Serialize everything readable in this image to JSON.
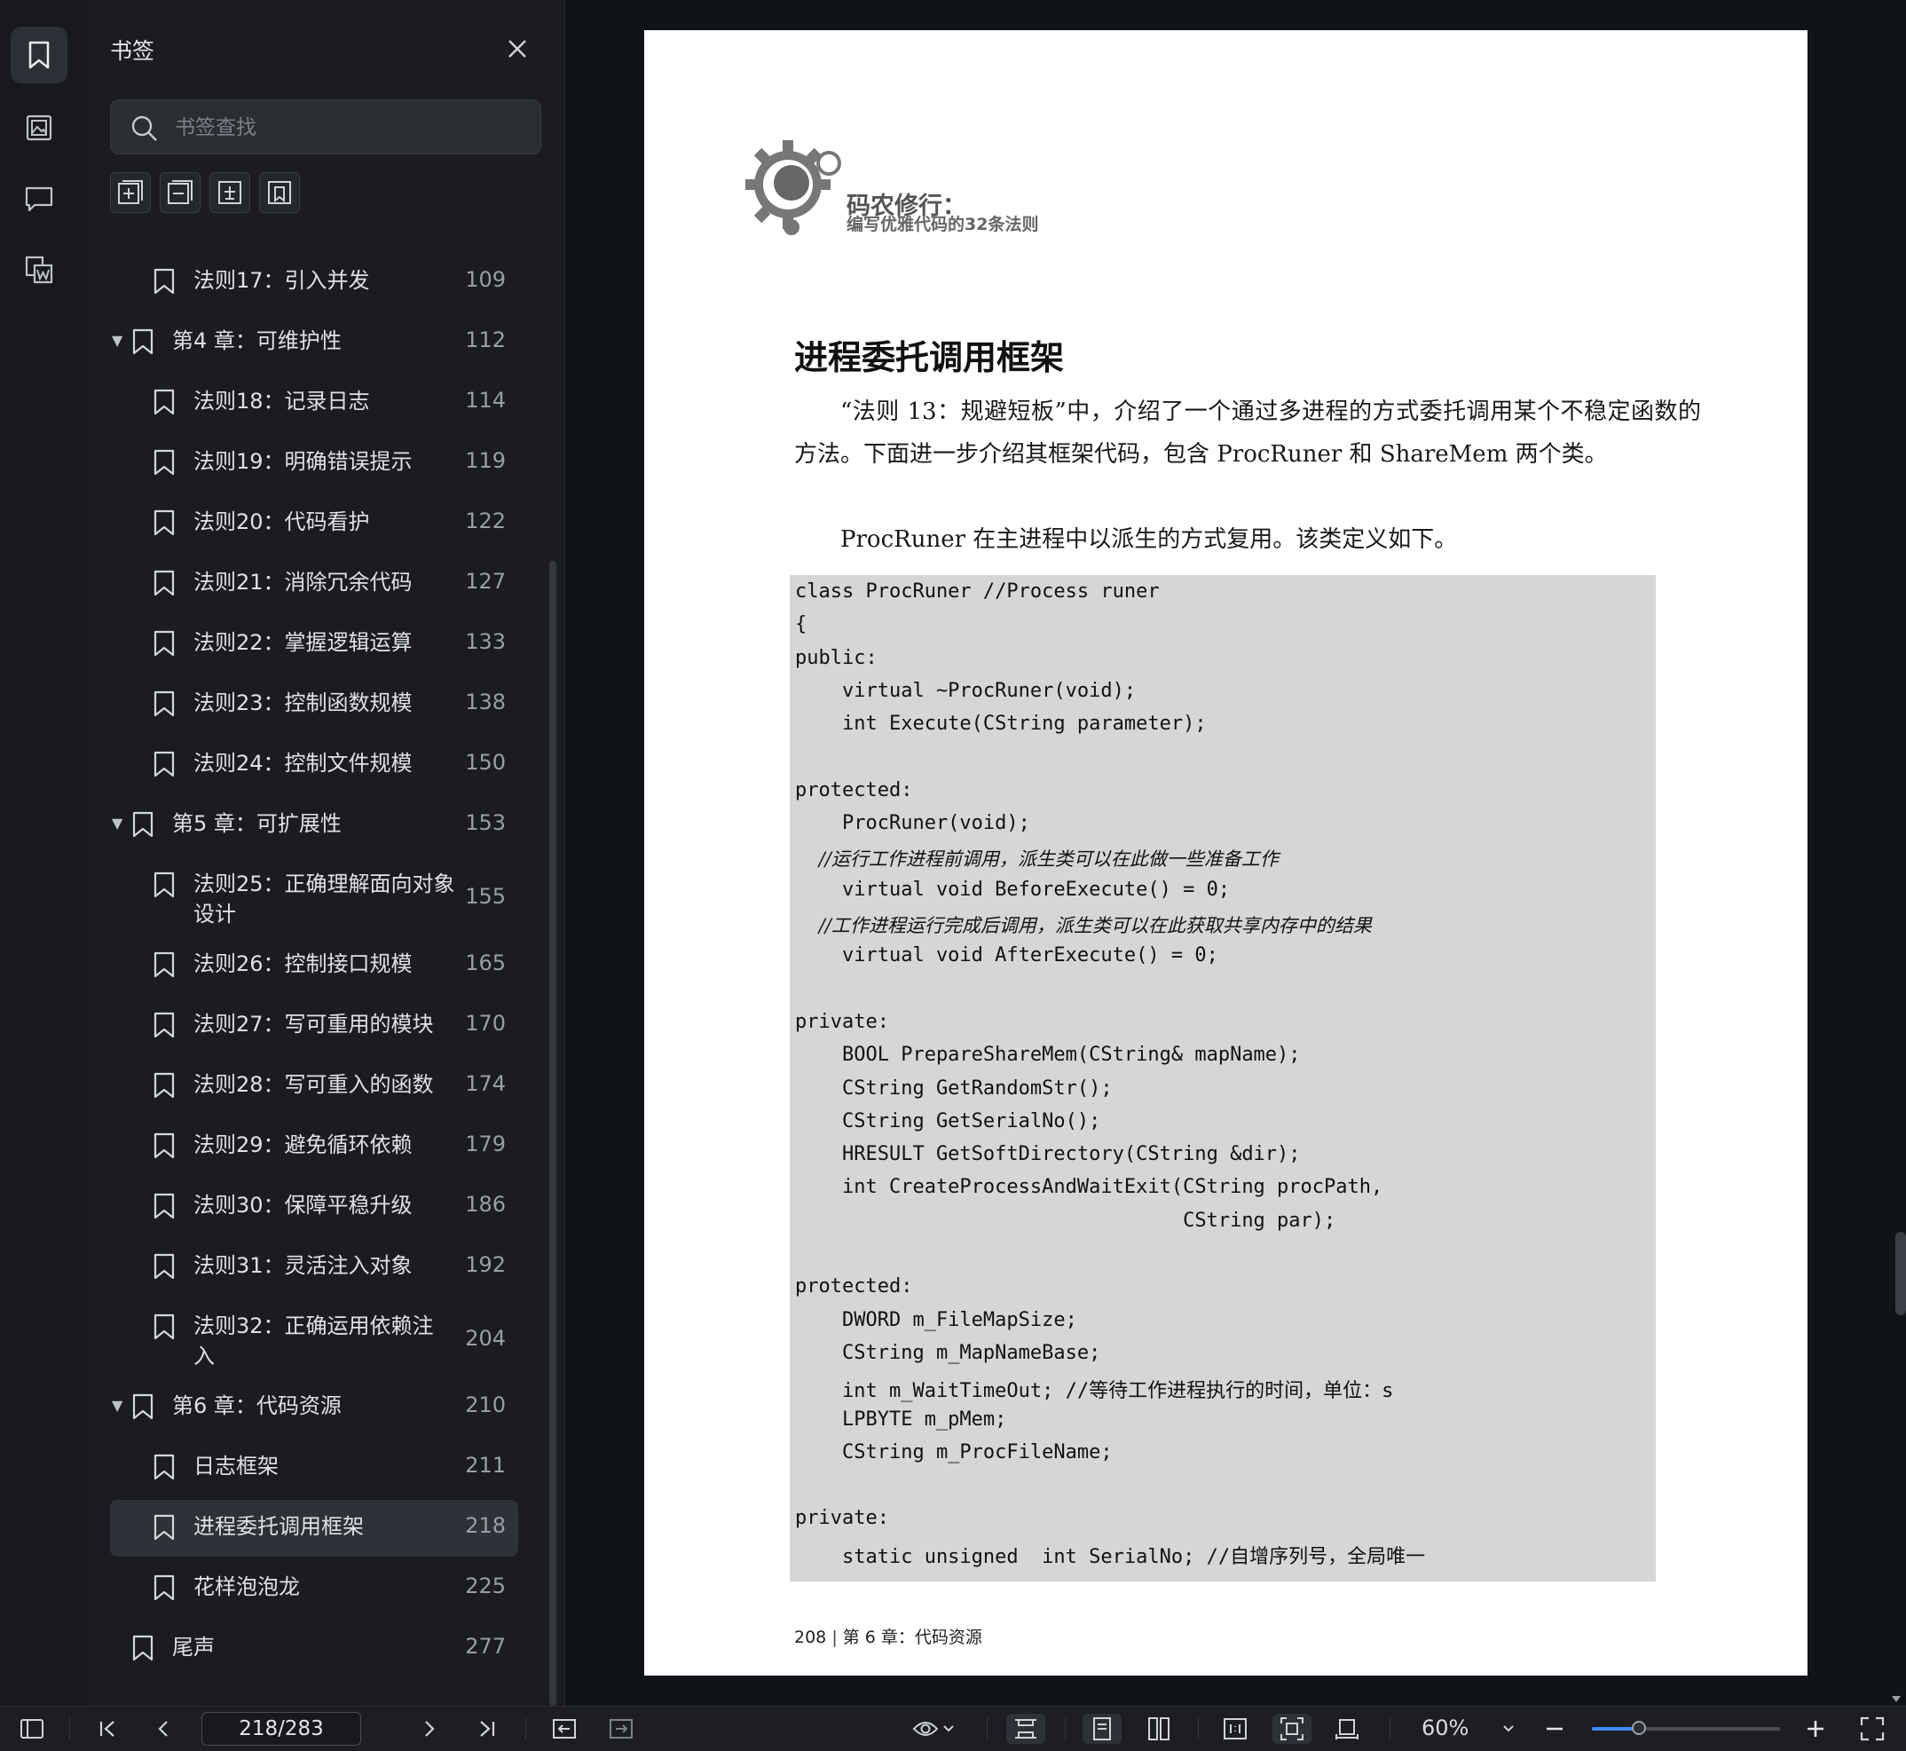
{
  "sidebar_panel": {
    "title": "书签",
    "search_placeholder": "书签查找",
    "bookmarks": [
      {
        "label": "法则17：引入并发",
        "page": "109",
        "level": 2,
        "expander": false,
        "selected": false
      },
      {
        "label": "第4 章：可维护性",
        "page": "112",
        "level": 1,
        "expander": true,
        "selected": false
      },
      {
        "label": "法则18：记录日志",
        "page": "114",
        "level": 2,
        "expander": false,
        "selected": false
      },
      {
        "label": "法则19：明确错误提示",
        "page": "119",
        "level": 2,
        "expander": false,
        "selected": false
      },
      {
        "label": "法则20：代码看护",
        "page": "122",
        "level": 2,
        "expander": false,
        "selected": false
      },
      {
        "label": "法则21：消除冗余代码",
        "page": "127",
        "level": 2,
        "expander": false,
        "selected": false
      },
      {
        "label": "法则22：掌握逻辑运算",
        "page": "133",
        "level": 2,
        "expander": false,
        "selected": false
      },
      {
        "label": "法则23：控制函数规模",
        "page": "138",
        "level": 2,
        "expander": false,
        "selected": false
      },
      {
        "label": "法则24：控制文件规模",
        "page": "150",
        "level": 2,
        "expander": false,
        "selected": false
      },
      {
        "label": "第5 章：可扩展性",
        "page": "153",
        "level": 1,
        "expander": true,
        "selected": false
      },
      {
        "label": "法则25：正确理解面向对象",
        "label2": "设计",
        "page": "155",
        "level": 2,
        "expander": false,
        "selected": false
      },
      {
        "label": "法则26：控制接口规模",
        "page": "165",
        "level": 2,
        "expander": false,
        "selected": false
      },
      {
        "label": "法则27：写可重用的模块",
        "page": "170",
        "level": 2,
        "expander": false,
        "selected": false
      },
      {
        "label": "法则28：写可重入的函数",
        "page": "174",
        "level": 2,
        "expander": false,
        "selected": false
      },
      {
        "label": "法则29：避免循环依赖",
        "page": "179",
        "level": 2,
        "expander": false,
        "selected": false
      },
      {
        "label": "法则30：保障平稳升级",
        "page": "186",
        "level": 2,
        "expander": false,
        "selected": false
      },
      {
        "label": "法则31：灵活注入对象",
        "page": "192",
        "level": 2,
        "expander": false,
        "selected": false
      },
      {
        "label": "法则32：正确运用依赖注",
        "label2": "入",
        "page": "204",
        "level": 2,
        "expander": false,
        "selected": false
      },
      {
        "label": "第6 章：代码资源",
        "page": "210",
        "level": 1,
        "expander": true,
        "selected": false
      },
      {
        "label": "日志框架",
        "page": "211",
        "level": 2,
        "expander": false,
        "selected": false
      },
      {
        "label": "进程委托调用框架",
        "page": "218",
        "level": 2,
        "expander": false,
        "selected": true
      },
      {
        "label": "花样泡泡龙",
        "page": "225",
        "level": 2,
        "expander": false,
        "selected": false
      },
      {
        "label": "尾声",
        "page": "277",
        "level": 0,
        "expander": false,
        "selected": false
      }
    ]
  },
  "document": {
    "logo_title": "码农修行：",
    "logo_subtitle": "编写优雅代码的32条法则",
    "heading": "进程委托调用框架",
    "paragraph1": "“法则 13：规避短板”中，介绍了一个通过多进程的方式委托调用某个不稳定函数的方法。下面进一步介绍其框架代码，包含 ProcRuner 和 ShareMem 两个类。",
    "paragraph2": "ProcRuner 在主进程中以派生的方式复用。该类定义如下。",
    "code_lines": [
      {
        "text": "class ProcRuner //Process runer",
        "comment": false
      },
      {
        "text": "{",
        "comment": false
      },
      {
        "text": "public:",
        "comment": false
      },
      {
        "text": "    virtual ~ProcRuner(void);",
        "comment": false
      },
      {
        "text": "    int Execute(CString parameter);",
        "comment": false
      },
      {
        "text": "",
        "comment": false
      },
      {
        "text": "protected:",
        "comment": false
      },
      {
        "text": "    ProcRuner(void);",
        "comment": false
      },
      {
        "text": "    //运行工作进程前调用，派生类可以在此做一些准备工作",
        "comment": true
      },
      {
        "text": "    virtual void BeforeExecute() = 0;",
        "comment": false
      },
      {
        "text": "    //工作进程运行完成后调用，派生类可以在此获取共享内存中的结果",
        "comment": true
      },
      {
        "text": "    virtual void AfterExecute() = 0;",
        "comment": false
      },
      {
        "text": "",
        "comment": false
      },
      {
        "text": "private:",
        "comment": false
      },
      {
        "text": "    BOOL PrepareShareMem(CString& mapName);",
        "comment": false
      },
      {
        "text": "    CString GetRandomStr();",
        "comment": false
      },
      {
        "text": "    CString GetSerialNo();",
        "comment": false
      },
      {
        "text": "    HRESULT GetSoftDirectory(CString &dir);",
        "comment": false
      },
      {
        "text": "    int CreateProcessAndWaitExit(CString procPath,",
        "comment": false
      },
      {
        "text": "                                 CString par);",
        "comment": false
      },
      {
        "text": "",
        "comment": false
      },
      {
        "text": "protected:",
        "comment": false
      },
      {
        "text": "    DWORD m_FileMapSize;",
        "comment": false
      },
      {
        "text": "    CString m_MapNameBase;",
        "comment": false
      },
      {
        "text": "    int m_WaitTimeOut; //等待工作进程执行的时间，单位：s",
        "comment": false
      },
      {
        "text": "    LPBYTE m_pMem;",
        "comment": false
      },
      {
        "text": "    CString m_ProcFileName;",
        "comment": false
      },
      {
        "text": "",
        "comment": false
      },
      {
        "text": "private:",
        "comment": false
      },
      {
        "text": "    static unsigned  int SerialNo; //自增序列号，全局唯一",
        "comment": false
      }
    ],
    "footer_page": "208",
    "footer_chapter": "第 6 章：代码资源"
  },
  "toolbar": {
    "page_indicator": "218/283",
    "zoom_label": "60%",
    "zoom_fraction": 0.25
  },
  "colors": {
    "accent": "#3d8bfd",
    "panel_bg": "#1a1c20",
    "selected_row": "#2e3137",
    "code_bg": "#d6d6d6"
  }
}
